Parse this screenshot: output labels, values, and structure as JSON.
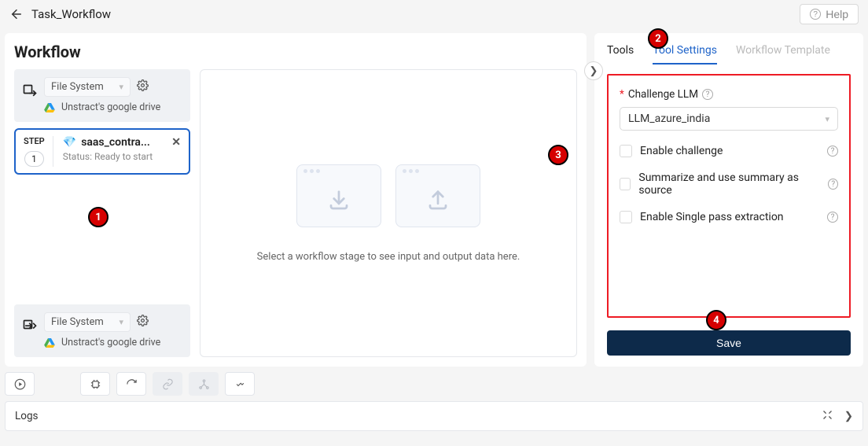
{
  "header": {
    "title": "Task_Workflow",
    "help": "Help"
  },
  "workflow": {
    "title": "Workflow",
    "input": {
      "type": "File System",
      "label": "Unstract's google drive"
    },
    "output": {
      "type": "File System",
      "label": "Unstract's google drive"
    },
    "step": {
      "badge": "STEP",
      "num": "1",
      "name": "saas_contra...",
      "status": "Status: Ready to start"
    },
    "placeholderText": "Select a workflow stage to see input and output data here."
  },
  "sidebar": {
    "tabs": {
      "tools": "Tools",
      "settings": "Tool Settings",
      "template": "Workflow Template"
    },
    "challenge": {
      "label": "Challenge LLM",
      "value": "LLM_azure_india"
    },
    "enableChallenge": "Enable challenge",
    "summarize": "Summarize and use summary as source",
    "singlePass": "Enable Single pass extraction",
    "save": "Save"
  },
  "logs": {
    "label": "Logs"
  },
  "callouts": {
    "c1": "1",
    "c2": "2",
    "c3": "3",
    "c4": "4"
  },
  "toolbar": {
    "play": "play"
  }
}
